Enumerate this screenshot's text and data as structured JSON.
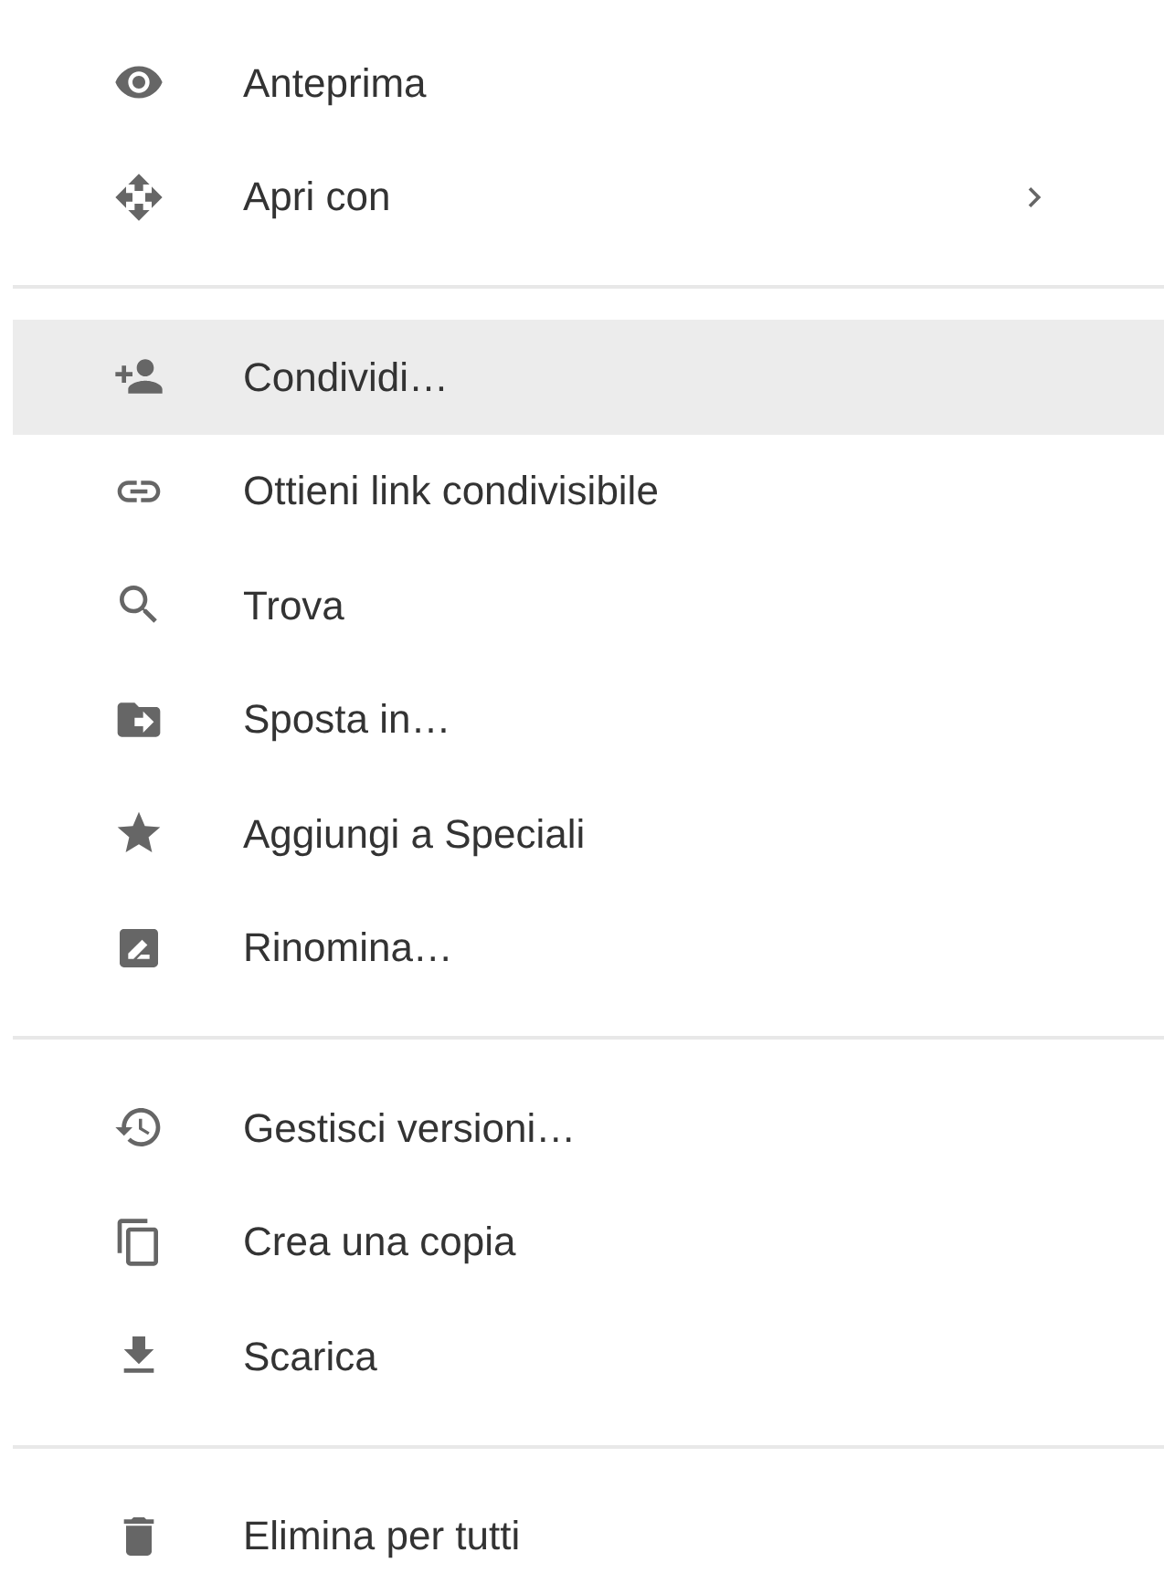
{
  "menu": {
    "groups": [
      {
        "items": [
          {
            "label": "Anteprima",
            "selected": false,
            "submenu": false
          },
          {
            "label": "Apri con",
            "selected": false,
            "submenu": true
          }
        ]
      },
      {
        "items": [
          {
            "label": "Condividi…",
            "selected": true,
            "submenu": false
          },
          {
            "label": "Ottieni link condivisibile",
            "selected": false,
            "submenu": false
          },
          {
            "label": "Trova",
            "selected": false,
            "submenu": false
          },
          {
            "label": "Sposta in…",
            "selected": false,
            "submenu": false
          },
          {
            "label": "Aggiungi a Speciali",
            "selected": false,
            "submenu": false
          },
          {
            "label": "Rinomina…",
            "selected": false,
            "submenu": false
          }
        ]
      },
      {
        "items": [
          {
            "label": "Gestisci versioni…",
            "selected": false,
            "submenu": false
          },
          {
            "label": "Crea una copia",
            "selected": false,
            "submenu": false
          },
          {
            "label": "Scarica",
            "selected": false,
            "submenu": false
          }
        ]
      },
      {
        "items": [
          {
            "label": "Elimina per tutti",
            "selected": false,
            "submenu": false
          }
        ]
      }
    ]
  }
}
